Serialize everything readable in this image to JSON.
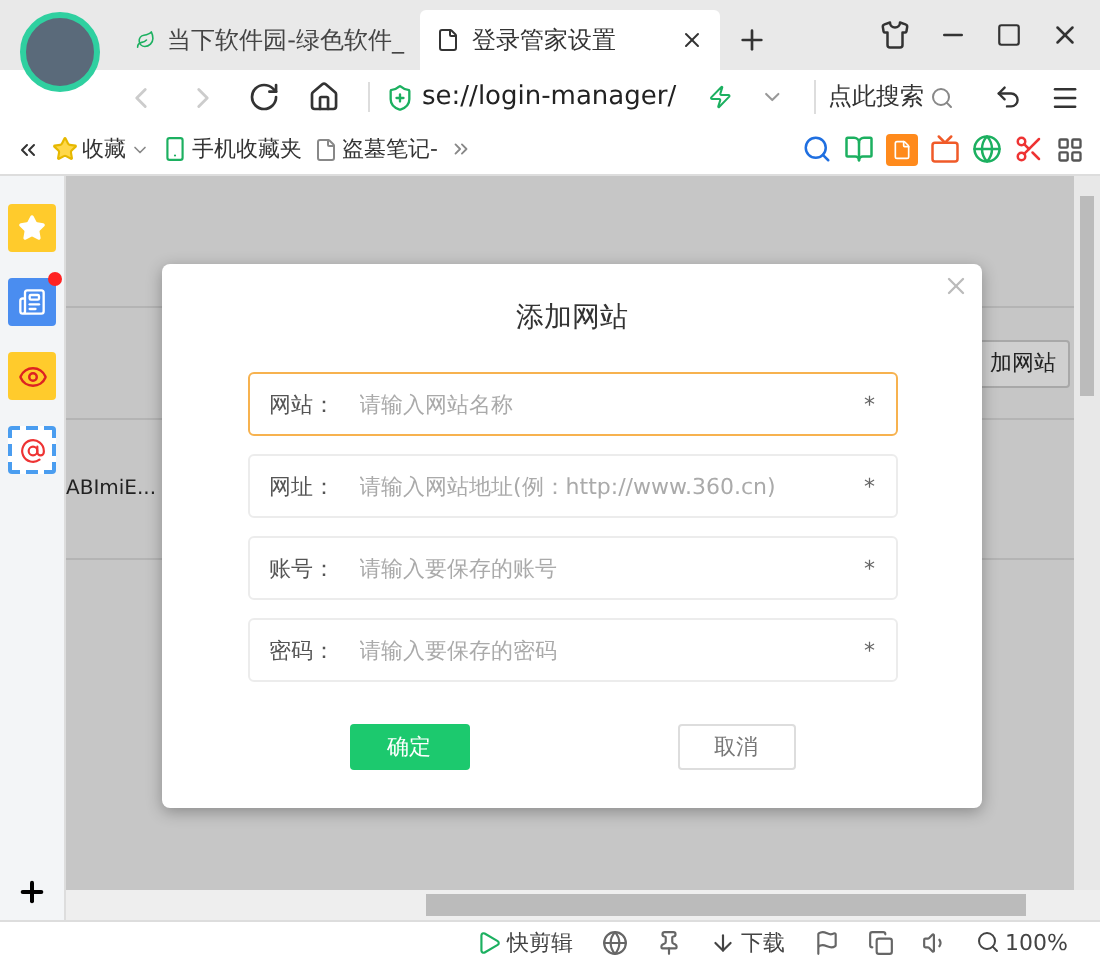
{
  "tabs": [
    {
      "title": "当下软件园-绿色软件_",
      "selected": false
    },
    {
      "title": "登录管家设置",
      "selected": true
    }
  ],
  "address_bar": {
    "url": "se://login-manager/",
    "search_button": "点此搜索"
  },
  "bookmarks": [
    {
      "label": "收藏",
      "kind": "star"
    },
    {
      "label": "手机收藏夹",
      "kind": "phone"
    },
    {
      "label": "盗墓笔记-",
      "kind": "page"
    }
  ],
  "page": {
    "add_site_button": "加网站",
    "row_text": "ABImiE..."
  },
  "dialog": {
    "title": "添加网站",
    "fields": [
      {
        "label": "网站：",
        "placeholder": "请输入网站名称",
        "required_mark": "*",
        "focused": true
      },
      {
        "label": "网址：",
        "placeholder": "请输入网站地址(例：http://www.360.cn)",
        "required_mark": "*",
        "focused": false
      },
      {
        "label": "账号：",
        "placeholder": "请输入要保存的账号",
        "required_mark": "*",
        "focused": false
      },
      {
        "label": "密码：",
        "placeholder": "请输入要保存的密码",
        "required_mark": "*",
        "focused": false
      }
    ],
    "confirm_button": "确定",
    "cancel_button": "取消"
  },
  "status_bar": {
    "clip_label": "快剪辑",
    "download_label": "下载",
    "zoom": "100%"
  }
}
